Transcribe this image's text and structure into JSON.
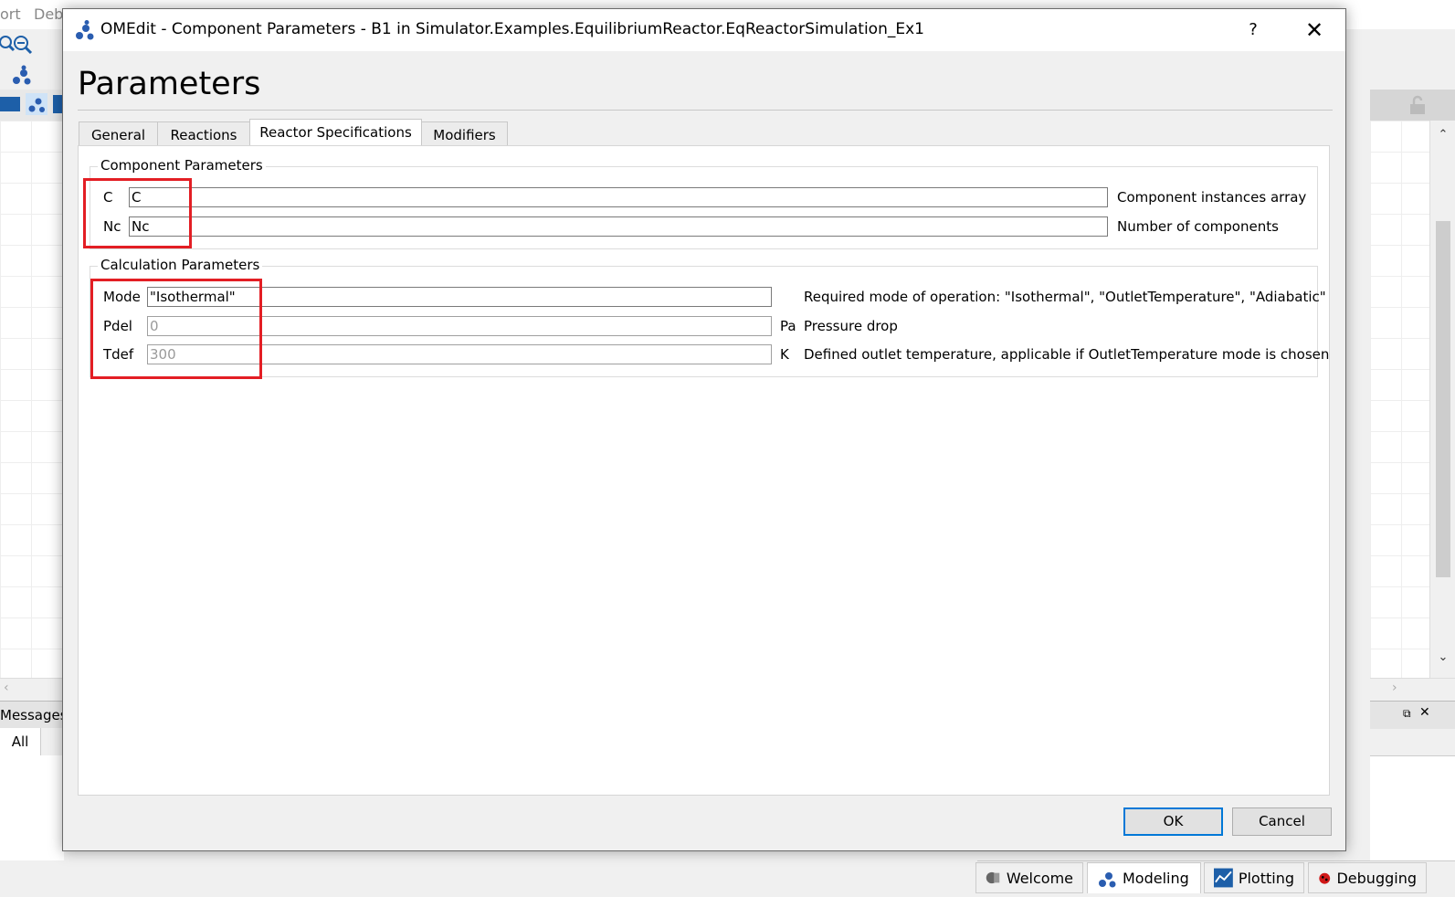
{
  "background": {
    "menu_items": [
      "ort",
      "Deb"
    ],
    "messages_label": "Messages",
    "messages_tab_all": "All",
    "perspectives": [
      {
        "label": "Welcome",
        "icon": "welcome-icon",
        "active": false
      },
      {
        "label": "Modeling",
        "icon": "modeling-icon",
        "active": true
      },
      {
        "label": "Plotting",
        "icon": "plotting-icon",
        "active": false
      },
      {
        "label": "Debugging",
        "icon": "debugging-icon",
        "active": false
      }
    ]
  },
  "dialog": {
    "window_title": "OMEdit - Component Parameters - B1 in Simulator.Examples.EquilibriumReactor.EqReactorSimulation_Ex1",
    "help_glyph": "?",
    "close_glyph": "✕",
    "heading": "Parameters",
    "tabs": [
      {
        "label": "General",
        "active": false
      },
      {
        "label": "Reactions",
        "active": false
      },
      {
        "label": "Reactor Specifications",
        "active": true
      },
      {
        "label": "Modifiers",
        "active": false
      }
    ],
    "component_parameters": {
      "title": "Component Parameters",
      "rows": [
        {
          "label": "C",
          "value": "C",
          "unit": "",
          "description": "Component instances array"
        },
        {
          "label": "Nc",
          "value": "Nc",
          "unit": "",
          "description": "Number of components"
        }
      ]
    },
    "calculation_parameters": {
      "title": "Calculation Parameters",
      "rows": [
        {
          "label": "Mode",
          "value": "\"Isothermal\"",
          "unit": "",
          "description": "Required mode of operation: \"Isothermal\", \"OutletTemperature\", \"Adiabatic\""
        },
        {
          "label": "Pdel",
          "placeholder": "0",
          "unit": "Pa",
          "description": "Pressure drop"
        },
        {
          "label": "Tdef",
          "placeholder": "300",
          "unit": "K",
          "description": "Defined outlet temperature, applicable if OutletTemperature mode is chosen"
        }
      ]
    },
    "ok_label": "OK",
    "cancel_label": "Cancel",
    "highlight_color": "#e31e24",
    "accent_color": "#0078d7"
  }
}
